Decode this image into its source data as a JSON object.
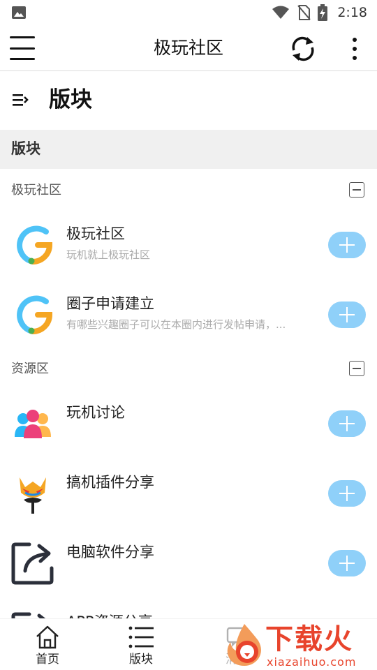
{
  "status_bar": {
    "time": "2:18"
  },
  "app_bar": {
    "title": "极玩社区"
  },
  "page": {
    "title": "版块"
  },
  "section": {
    "title": "版块"
  },
  "groups": [
    {
      "title": "极玩社区",
      "items": [
        {
          "title": "极玩社区",
          "desc": "玩机就上极玩社区",
          "icon": "g-logo-icon"
        },
        {
          "title": "圈子申请建立",
          "desc": "有哪些兴趣圈子可以在本圈内进行发帖申请，...",
          "icon": "g-logo-icon"
        }
      ]
    },
    {
      "title": "资源区",
      "items": [
        {
          "title": "玩机讨论",
          "desc": "",
          "icon": "people-group-icon"
        },
        {
          "title": "搞机插件分享",
          "desc": "",
          "icon": "opera-mask-icon"
        },
        {
          "title": "电脑软件分享",
          "desc": "",
          "icon": "share-arrow-icon"
        },
        {
          "title": "APP资源分享",
          "desc": "",
          "icon": "share-arrow-icon"
        }
      ]
    }
  ],
  "bottom_nav": {
    "home_label": "首页",
    "forum_label": "版块",
    "message_label": "消息"
  },
  "watermark": {
    "main": "下载火",
    "sub": "xiazaihuo.com"
  },
  "colors": {
    "accent": "#8fd0f9",
    "watermark": "#e8442c"
  }
}
